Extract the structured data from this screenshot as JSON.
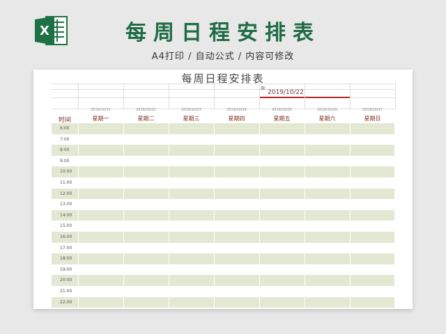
{
  "header": {
    "title": "每周日程安排表",
    "subtitle": "A4打印 / 自动公式 / 内容可修改",
    "logo_icon": "excel-icon",
    "logo_color": "#1e7145"
  },
  "sheet": {
    "title": "每周日程安排表",
    "week_label": "周:",
    "week_date": "2019/10/22",
    "time_header": "时间",
    "days": [
      {
        "date": "2019/10/21",
        "label": "星期一"
      },
      {
        "date": "2019/10/22",
        "label": "星期二"
      },
      {
        "date": "2019/10/23",
        "label": "星期三"
      },
      {
        "date": "2019/10/24",
        "label": "星期四"
      },
      {
        "date": "2019/10/25",
        "label": "星期五"
      },
      {
        "date": "2019/10/26",
        "label": "星期六"
      },
      {
        "date": "2019/10/27",
        "label": "星期日"
      }
    ],
    "times": [
      "6:00",
      "7:00",
      "8:00",
      "9:00",
      "10:00",
      "11:00",
      "12:00",
      "13:00",
      "14:00",
      "15:00",
      "16:00",
      "17:00",
      "18:00",
      "19:00",
      "20:00",
      "21:00",
      "22:00"
    ],
    "stripe_color": "#e3e8d3",
    "accent_color": "#b22222"
  }
}
